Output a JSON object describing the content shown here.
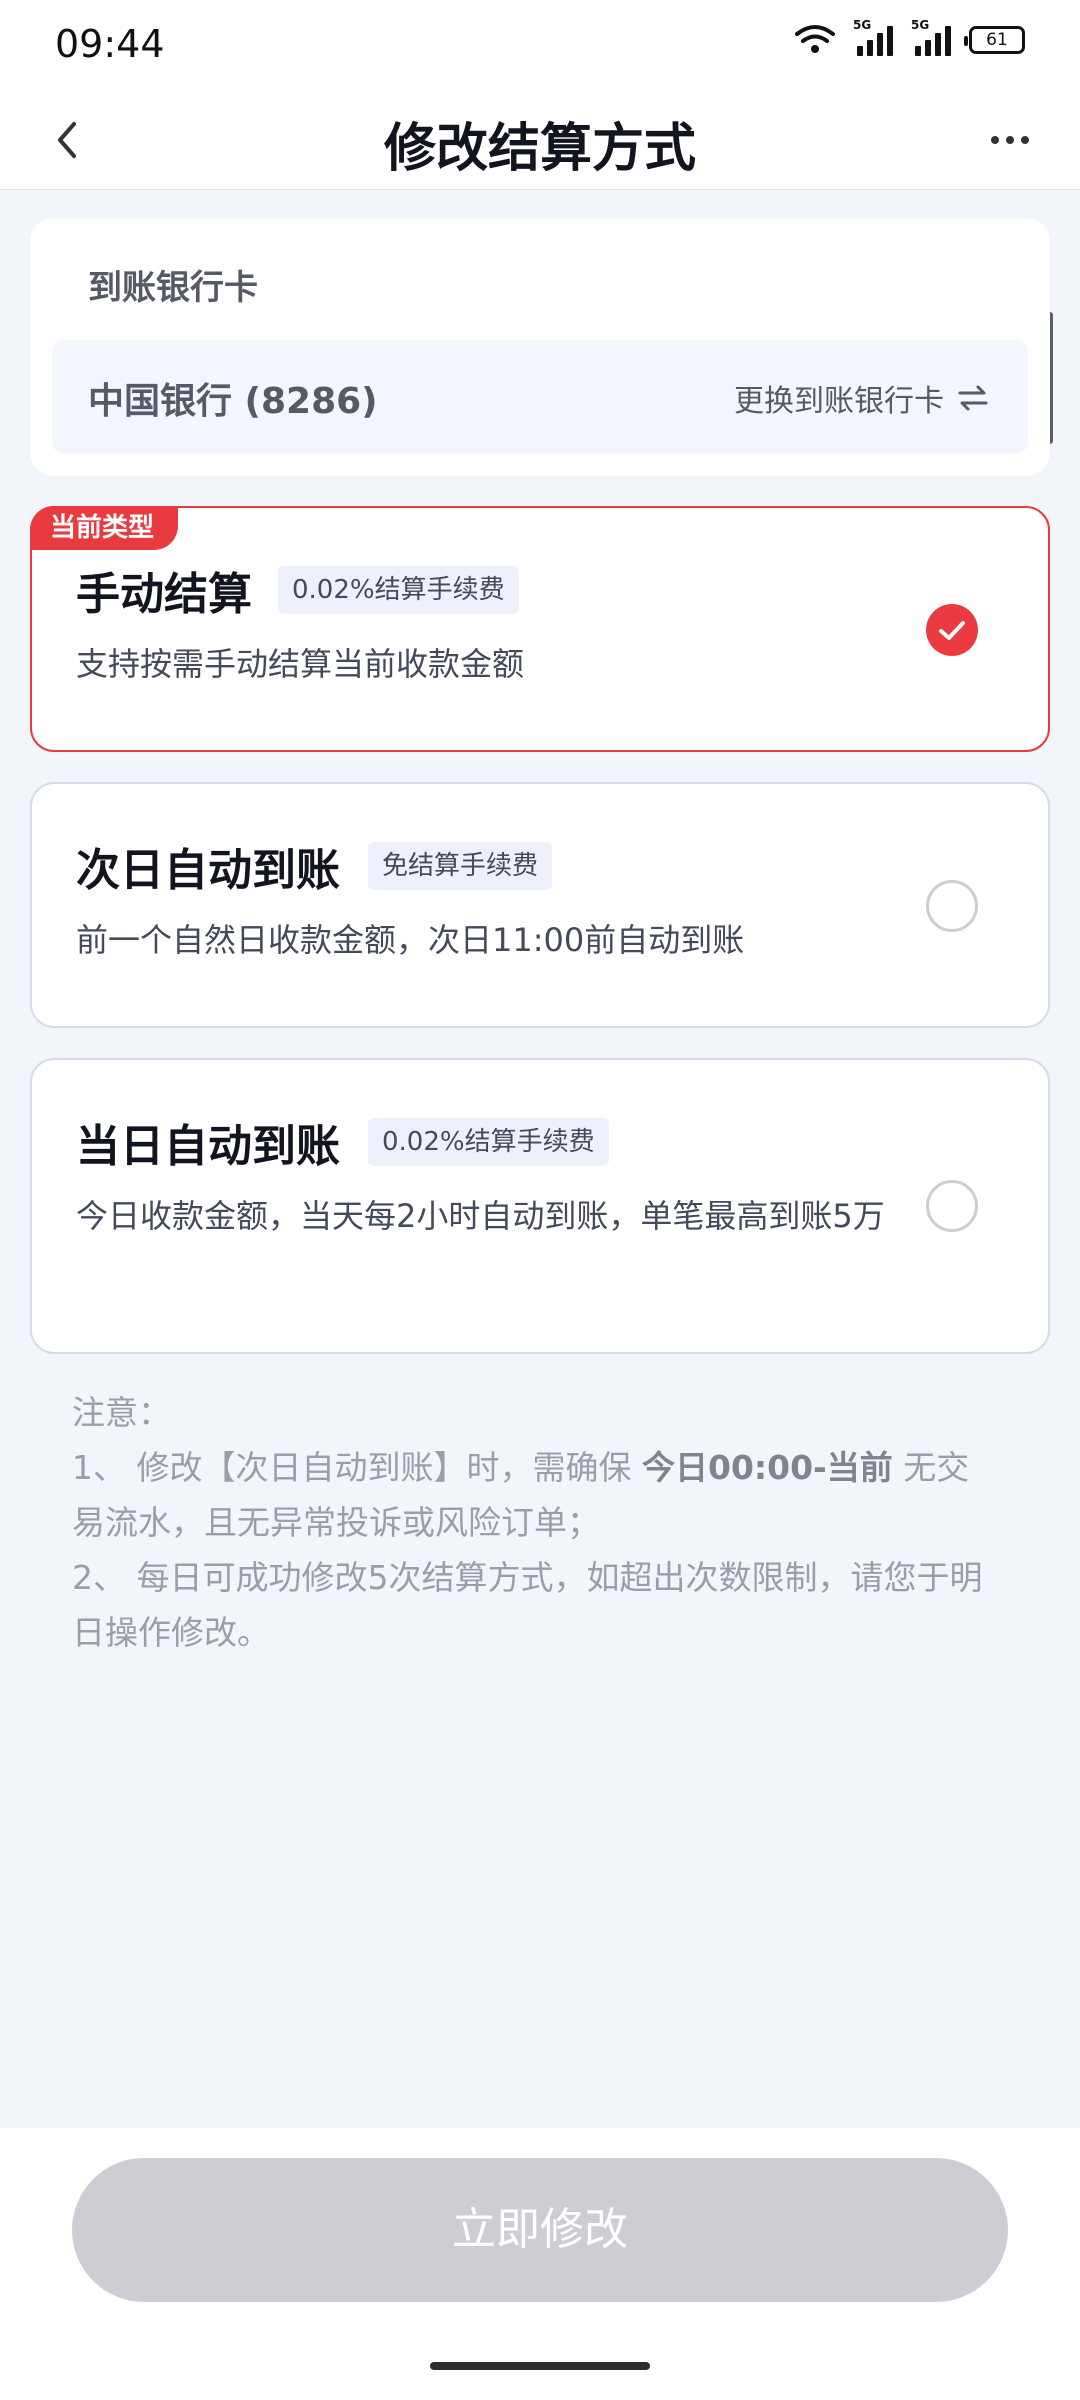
{
  "status_bar": {
    "time": "09:44",
    "signal_label_1": "5G",
    "signal_label_2": "5G",
    "battery": "61"
  },
  "nav": {
    "title": "修改结算方式",
    "back_icon": "chevron-left-icon",
    "more_icon": "more-dots-icon"
  },
  "bank": {
    "header": "到账银行卡",
    "bank_name": "中国银行 (8286)",
    "change_label": "更换到账银行卡"
  },
  "options": [
    {
      "tag": "当前类型",
      "title": "手动结算",
      "fee": "0.02%结算手续费",
      "description": "支持按需手动结算当前收款金额",
      "selected": true
    },
    {
      "title": "次日自动到账",
      "fee": "免结算手续费",
      "description": "前一个自然日收款金额，次日11:00前自动到账",
      "selected": false
    },
    {
      "title": "当日自动到账",
      "fee": "0.02%结算手续费",
      "description": "今日收款金额，当天每2小时自动到账，单笔最高到账5万",
      "selected": false
    }
  ],
  "notice": {
    "heading": "注意：",
    "line1_prefix": "1、 修改【次日自动到账】时，需确保 ",
    "line1_bold": "今日00:00-当前",
    "line1_suffix": " 无交易流水，且无异常投诉或风险订单；",
    "line2": "2、 每日可成功修改5次结算方式，如超出次数限制，请您于明日操作修改。"
  },
  "submit": {
    "label": "立即修改",
    "disabled": true
  },
  "colors": {
    "accent_red": "#e83a3f",
    "page_bg": "#f2f5fa",
    "disabled_button": "#cdced3"
  }
}
